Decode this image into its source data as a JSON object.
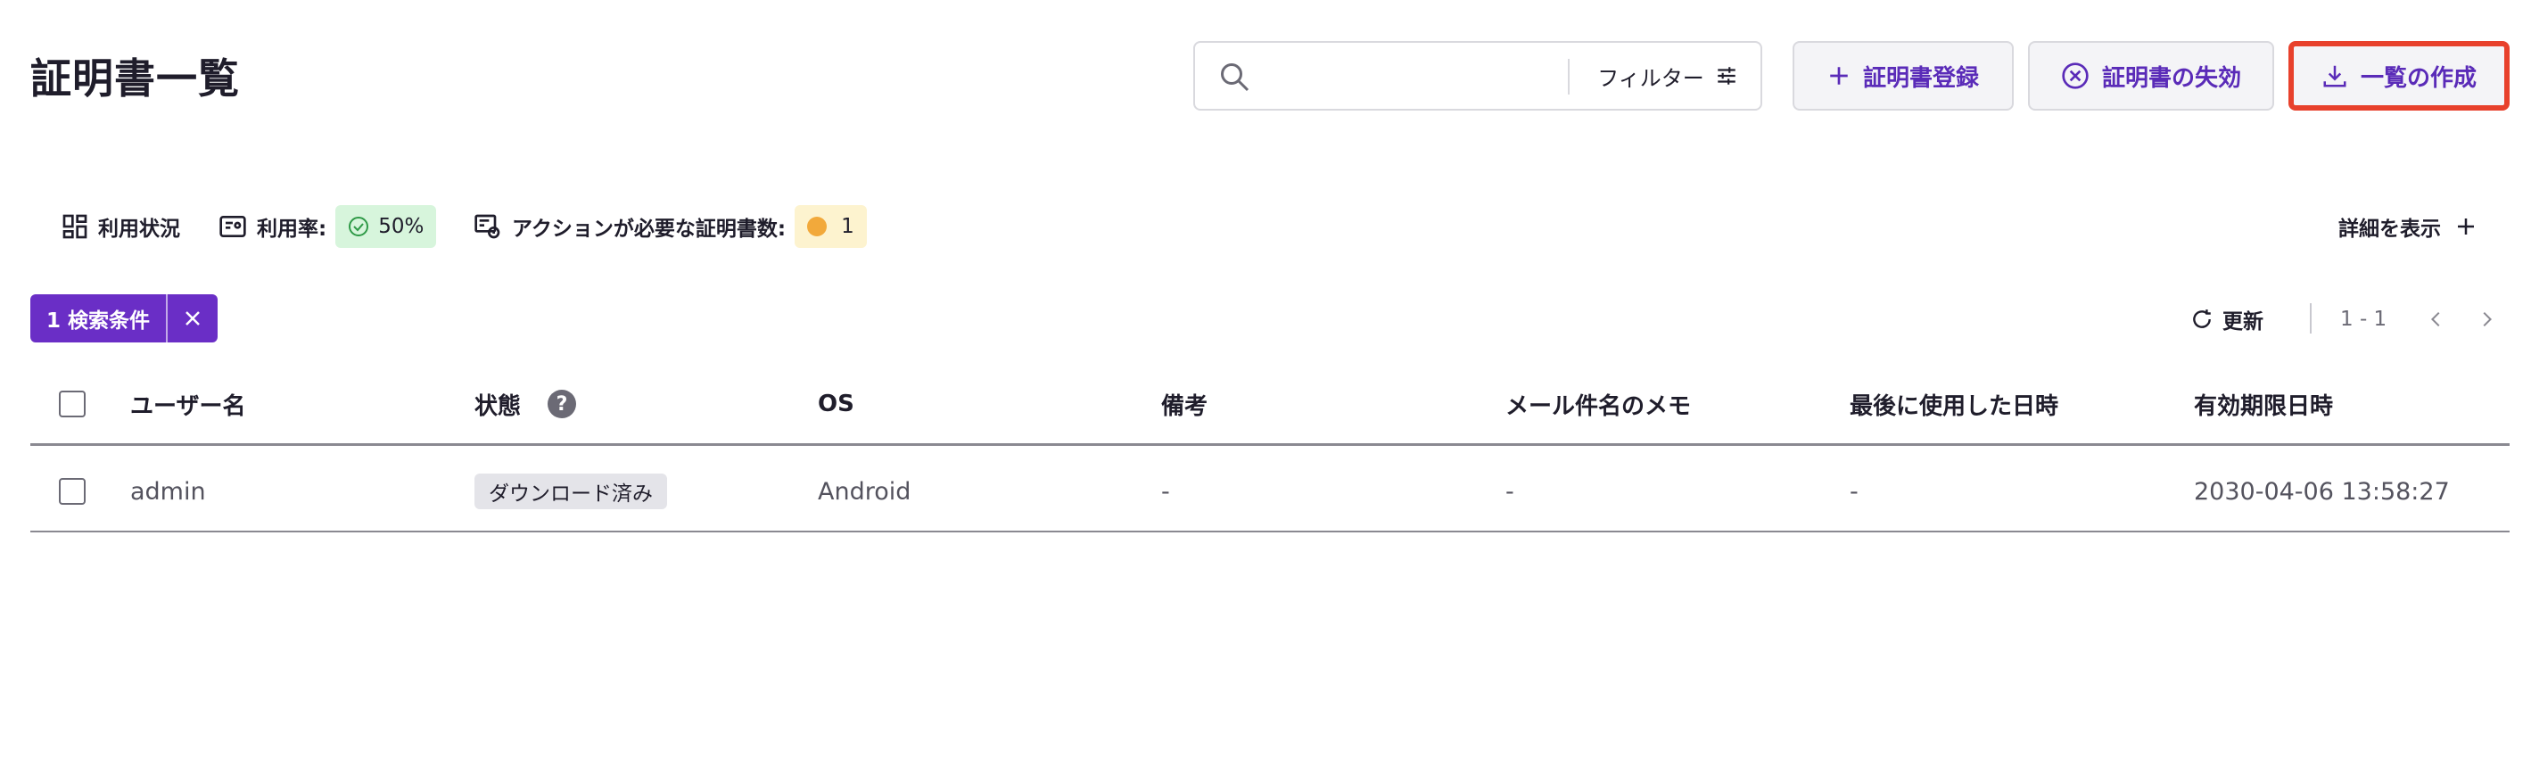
{
  "header": {
    "title": "証明書一覧",
    "search": {
      "placeholder": "",
      "value": ""
    },
    "filter_label": "フィルター",
    "buttons": {
      "register": "証明書登録",
      "revoke": "証明書の失効",
      "export": "一覧の作成"
    }
  },
  "stats": {
    "usage_label": "利用状況",
    "rate_label": "利用率:",
    "rate_value": "50%",
    "action_label": "アクションが必要な証明書数:",
    "action_value": "1",
    "details_label": "詳細を表示"
  },
  "filter_chip": {
    "label": "1 検索条件"
  },
  "pagination": {
    "refresh_label": "更新",
    "range": "1 - 1"
  },
  "table": {
    "columns": [
      "ユーザー名",
      "状態",
      "OS",
      "備考",
      "メール件名のメモ",
      "最後に使用した日時",
      "有効期限日時"
    ],
    "rows": [
      {
        "username": "admin",
        "status": "ダウンロード済み",
        "os": "Android",
        "note": "-",
        "mail_memo": "-",
        "last_used": "-",
        "expires": "2030-04-06 13:58:27"
      }
    ]
  },
  "colors": {
    "accent": "#5a2bb8",
    "chip": "#6a2ec6",
    "highlight": "#e8412c",
    "success_bg": "#d7f5dc",
    "warning_bg": "#fdf3cf"
  }
}
